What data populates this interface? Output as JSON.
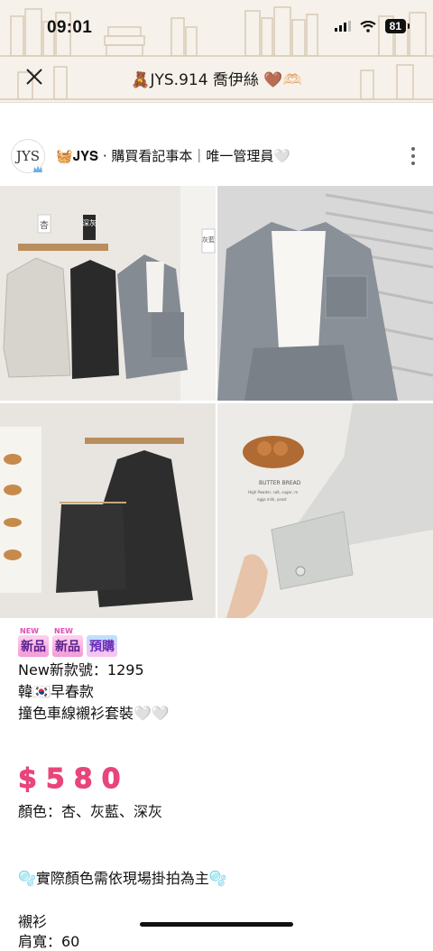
{
  "status_bar": {
    "time": "09:01",
    "battery": "81"
  },
  "header": {
    "title": "🧸JYS.914 喬伊絲 🤎🫶🏻"
  },
  "post": {
    "avatar_text": "JYS",
    "author": "🧺𝐉𝐘𝐒 · 購買看記事本｜唯一管理員🤍"
  },
  "photos": [
    {
      "labels": [
        "杏",
        "深灰",
        "灰藍"
      ]
    },
    {
      "labels": []
    },
    {
      "labels": []
    },
    {
      "labels": [
        "BUTTER BREAD",
        "High Powder, salt, sugar, m",
        "eggs milk, yeast"
      ]
    }
  ],
  "tags": {
    "new1": "新品",
    "new2": "新品",
    "pre": "預購",
    "mini": "NEW"
  },
  "lines": {
    "style_no": "New新款號：1295",
    "origin": "韓🇰🇷早春款",
    "desc": "撞色車線襯衫套裝🤍🤍",
    "price": "$580",
    "colors": "顏色：杏、灰藍、深灰",
    "note": "🫧實際顏色需依現場掛拍為主🫧",
    "item": "襯衫",
    "cut": "肩寬：60"
  },
  "colors": {
    "price": "#e8457a",
    "header_bg": "#f6f1ea"
  }
}
